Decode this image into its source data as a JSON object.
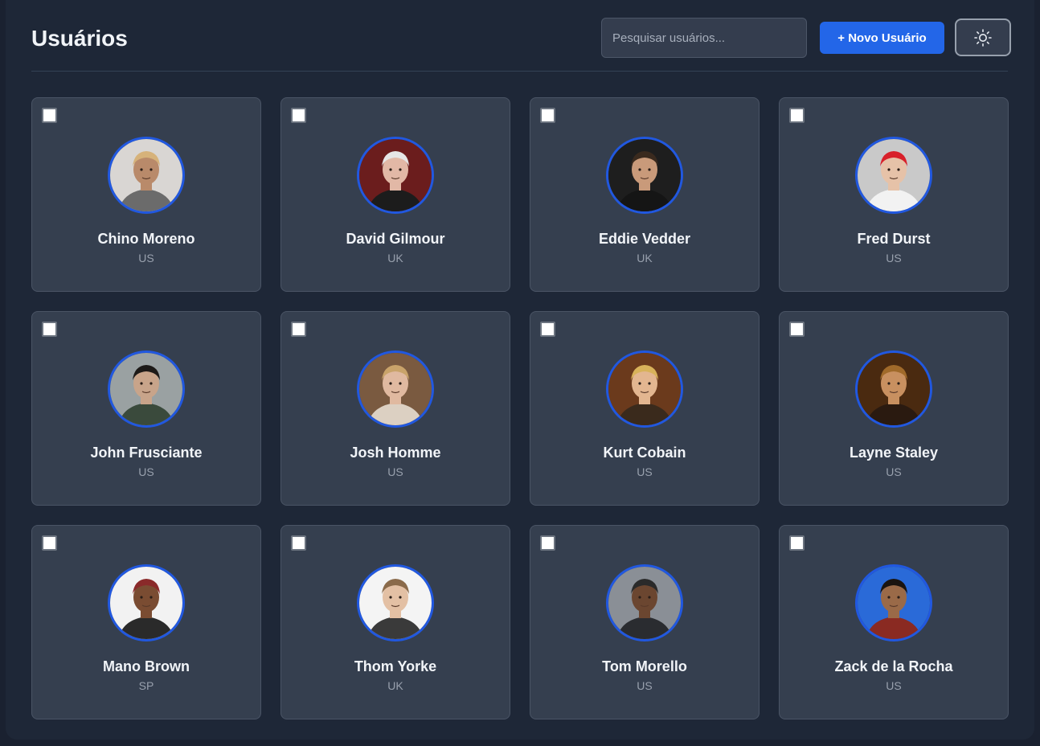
{
  "header": {
    "title": "Usuários",
    "search_placeholder": "Pesquisar usuários...",
    "search_value": "",
    "new_user_label": "+ Novo Usuário",
    "theme_toggle_icon": "sun-icon"
  },
  "colors": {
    "accent": "#2366e8",
    "avatar_ring": "#2158e0",
    "card_bg": "#353f4f",
    "page_bg": "#1e2737"
  },
  "users": [
    {
      "name": "Chino Moreno",
      "country": "US",
      "checked": false,
      "photo": {
        "bg": "#d9d6d3",
        "skin": "#b98a6a",
        "hair": "#d6b27a",
        "shirt": "#6b6b6b"
      }
    },
    {
      "name": "David Gilmour",
      "country": "UK",
      "checked": false,
      "photo": {
        "bg": "#6b1d1d",
        "skin": "#e2b8a6",
        "hair": "#e6e6e6",
        "shirt": "#1c1c1c"
      }
    },
    {
      "name": "Eddie Vedder",
      "country": "UK",
      "checked": false,
      "photo": {
        "bg": "#1e1e1e",
        "skin": "#c99a7a",
        "hair": "#3a2a1e",
        "shirt": "#151515"
      }
    },
    {
      "name": "Fred Durst",
      "country": "US",
      "checked": false,
      "photo": {
        "bg": "#c9c9c9",
        "skin": "#e6c2a8",
        "hair": "#d8202a",
        "shirt": "#f2f2f2"
      }
    },
    {
      "name": "John Frusciante",
      "country": "US",
      "checked": false,
      "photo": {
        "bg": "#9aa1a2",
        "skin": "#c8a48a",
        "hair": "#1d1a18",
        "shirt": "#3a4a3c"
      }
    },
    {
      "name": "Josh Homme",
      "country": "US",
      "checked": false,
      "photo": {
        "bg": "#7a5a40",
        "skin": "#e0b9a0",
        "hair": "#c9a36a",
        "shirt": "#dcd0c2"
      }
    },
    {
      "name": "Kurt Cobain",
      "country": "US",
      "checked": false,
      "photo": {
        "bg": "#6b3a1c",
        "skin": "#e3b690",
        "hair": "#d8b25a",
        "shirt": "#3a2a1c"
      }
    },
    {
      "name": "Layne Staley",
      "country": "US",
      "checked": false,
      "photo": {
        "bg": "#4a2a10",
        "skin": "#c89060",
        "hair": "#a06a2a",
        "shirt": "#2a1a10"
      }
    },
    {
      "name": "Mano Brown",
      "country": "SP",
      "checked": false,
      "photo": {
        "bg": "#f2f2f2",
        "skin": "#7a4c32",
        "hair": "#8a2a2a",
        "shirt": "#2a2a2a"
      }
    },
    {
      "name": "Thom Yorke",
      "country": "UK",
      "checked": false,
      "photo": {
        "bg": "#f4f4f4",
        "skin": "#e3c0a4",
        "hair": "#8a6a4a",
        "shirt": "#3a3a3a"
      }
    },
    {
      "name": "Tom Morello",
      "country": "US",
      "checked": false,
      "photo": {
        "bg": "#8a8f96",
        "skin": "#6b4630",
        "hair": "#2a2a2a",
        "shirt": "#2a2c30"
      }
    },
    {
      "name": "Zack de la Rocha",
      "country": "US",
      "checked": false,
      "photo": {
        "bg": "#2a6ad8",
        "skin": "#9a6a48",
        "hair": "#1a1410",
        "shirt": "#8a2a22"
      }
    }
  ]
}
